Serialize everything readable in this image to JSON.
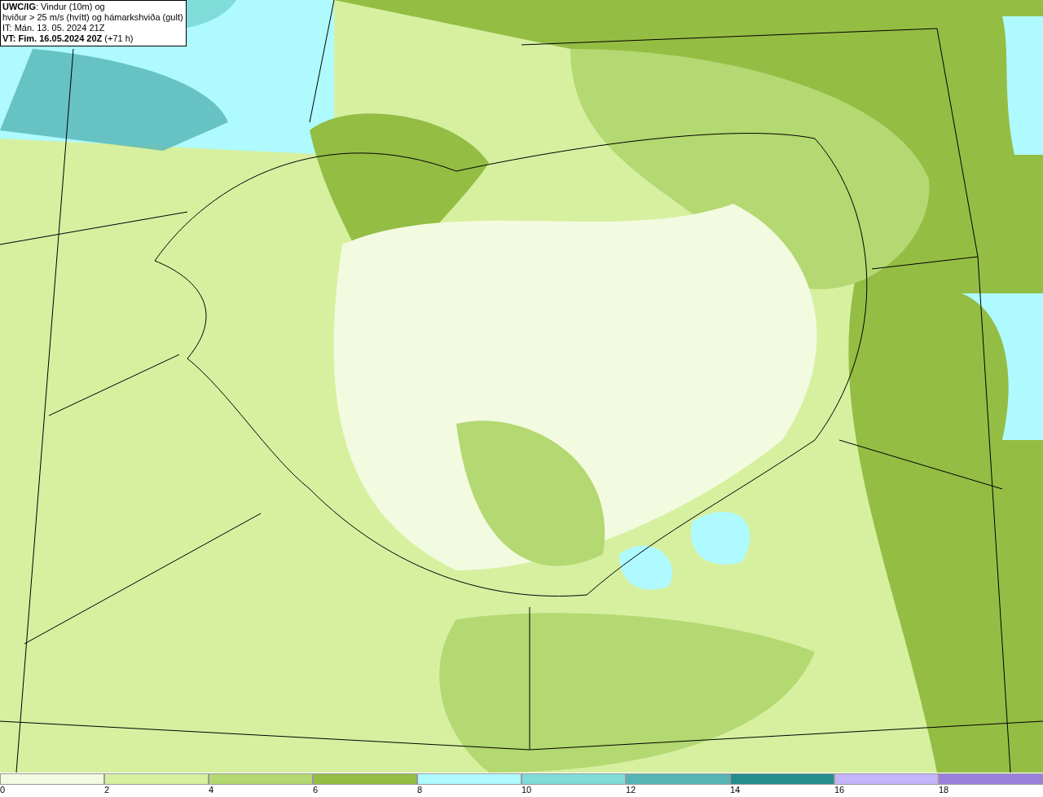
{
  "map": {
    "legend": {
      "lines": [
        "**UWC/IG**: Vindur (10m) og",
        "hviður > 25 m/s (hvítt) og hámarkshviða (gult)",
        "IT: Mán. 13. 05. 2024 21Z",
        "**VT: Fim. 16.05.2024 20Z** (+71 h)"
      ]
    }
  },
  "colorbar": {
    "bins": [
      {
        "label": "0",
        "color": "#f2fbdf"
      },
      {
        "label": "2",
        "color": "#d6f0a0"
      },
      {
        "label": "4",
        "color": "#b4d872"
      },
      {
        "label": "6",
        "color": "#94bd44"
      },
      {
        "label": "8",
        "color": "#aefaff"
      },
      {
        "label": "10",
        "color": "#7fdcd9"
      },
      {
        "label": "12",
        "color": "#55b4b4"
      },
      {
        "label": "14",
        "color": "#238e8c"
      },
      {
        "label": "16",
        "color": "#c4b4fa"
      },
      {
        "label": "18",
        "color": "#9a80dc"
      }
    ]
  }
}
